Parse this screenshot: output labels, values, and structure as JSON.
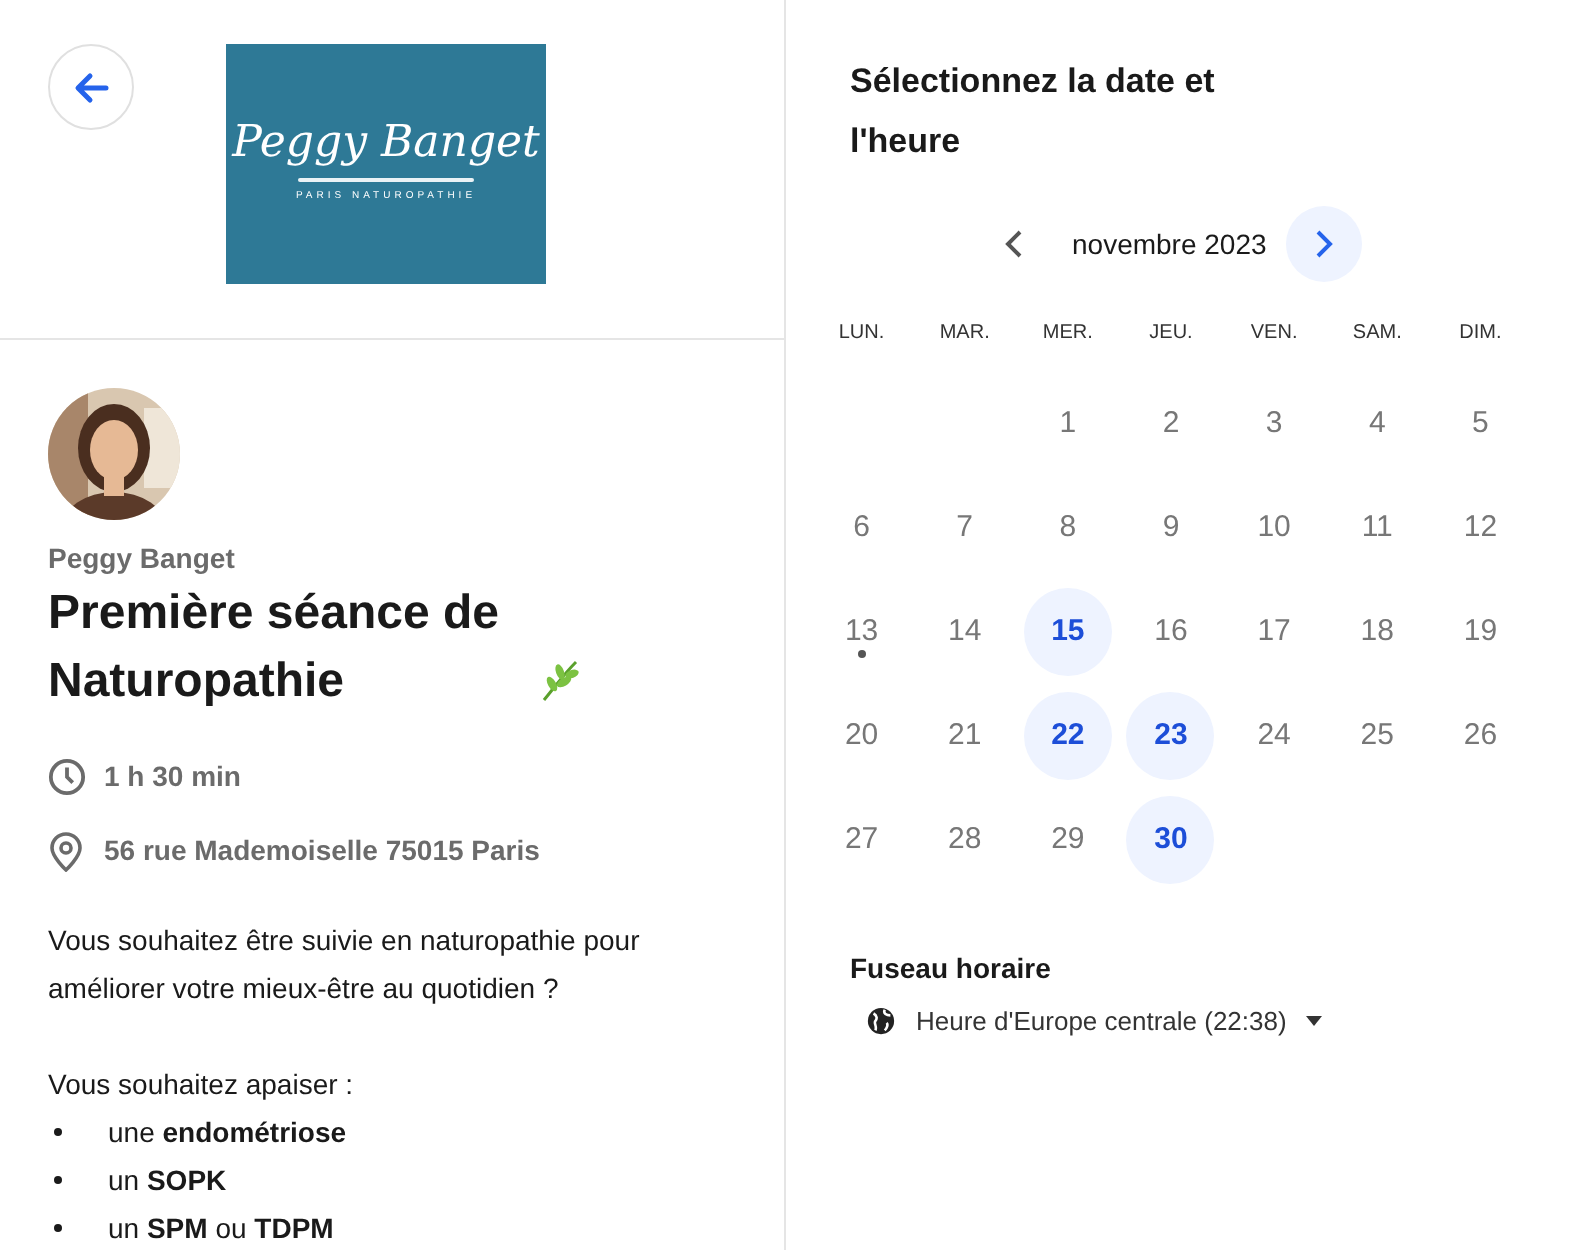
{
  "logo": {
    "name": "Peggy Banget",
    "tagline": "PARIS NATUROPATHIE"
  },
  "host": "Peggy Banget",
  "title": "Première séance de Naturopathie",
  "duration": "1 h 30 min",
  "address": "56 rue Mademoiselle 75015 Paris",
  "description": [
    "Vous souhaitez être suivie en naturopathie pour améliorer votre mieux-être au quotidien ?",
    "Vous souhaitez apaiser :"
  ],
  "bullets": [
    "une **endométriose**",
    "un **SOPK**",
    "un **SPM** ou **TDPM**"
  ],
  "calendar": {
    "heading": "Sélectionnez la date et l'heure",
    "month": "novembre 2023",
    "weekdays": [
      "LUN.",
      "MAR.",
      "MER.",
      "JEU.",
      "VEN.",
      "SAM.",
      "DIM."
    ],
    "days": [
      {
        "kind": "empty"
      },
      {
        "kind": "empty"
      },
      {
        "kind": "day",
        "label": "1",
        "available": false,
        "today": false
      },
      {
        "kind": "day",
        "label": "2",
        "available": false,
        "today": false
      },
      {
        "kind": "day",
        "label": "3",
        "available": false,
        "today": false
      },
      {
        "kind": "day",
        "label": "4",
        "available": false,
        "today": false
      },
      {
        "kind": "day",
        "label": "5",
        "available": false,
        "today": false
      },
      {
        "kind": "day",
        "label": "6",
        "available": false,
        "today": false
      },
      {
        "kind": "day",
        "label": "7",
        "available": false,
        "today": false
      },
      {
        "kind": "day",
        "label": "8",
        "available": false,
        "today": false
      },
      {
        "kind": "day",
        "label": "9",
        "available": false,
        "today": false
      },
      {
        "kind": "day",
        "label": "10",
        "available": false,
        "today": false
      },
      {
        "kind": "day",
        "label": "11",
        "available": false,
        "today": false
      },
      {
        "kind": "day",
        "label": "12",
        "available": false,
        "today": false
      },
      {
        "kind": "day",
        "label": "13",
        "available": false,
        "today": true
      },
      {
        "kind": "day",
        "label": "14",
        "available": false,
        "today": false
      },
      {
        "kind": "day",
        "label": "15",
        "available": true,
        "today": false
      },
      {
        "kind": "day",
        "label": "16",
        "available": false,
        "today": false
      },
      {
        "kind": "day",
        "label": "17",
        "available": false,
        "today": false
      },
      {
        "kind": "day",
        "label": "18",
        "available": false,
        "today": false
      },
      {
        "kind": "day",
        "label": "19",
        "available": false,
        "today": false
      },
      {
        "kind": "day",
        "label": "20",
        "available": false,
        "today": false
      },
      {
        "kind": "day",
        "label": "21",
        "available": false,
        "today": false
      },
      {
        "kind": "day",
        "label": "22",
        "available": true,
        "today": false
      },
      {
        "kind": "day",
        "label": "23",
        "available": true,
        "today": false
      },
      {
        "kind": "day",
        "label": "24",
        "available": false,
        "today": false
      },
      {
        "kind": "day",
        "label": "25",
        "available": false,
        "today": false
      },
      {
        "kind": "day",
        "label": "26",
        "available": false,
        "today": false
      },
      {
        "kind": "day",
        "label": "27",
        "available": false,
        "today": false
      },
      {
        "kind": "day",
        "label": "28",
        "available": false,
        "today": false
      },
      {
        "kind": "day",
        "label": "29",
        "available": false,
        "today": false
      },
      {
        "kind": "day",
        "label": "30",
        "available": true,
        "today": false
      }
    ]
  },
  "timezone": {
    "label": "Fuseau horaire",
    "value": "Heure d'Europe centrale (22:38)"
  }
}
